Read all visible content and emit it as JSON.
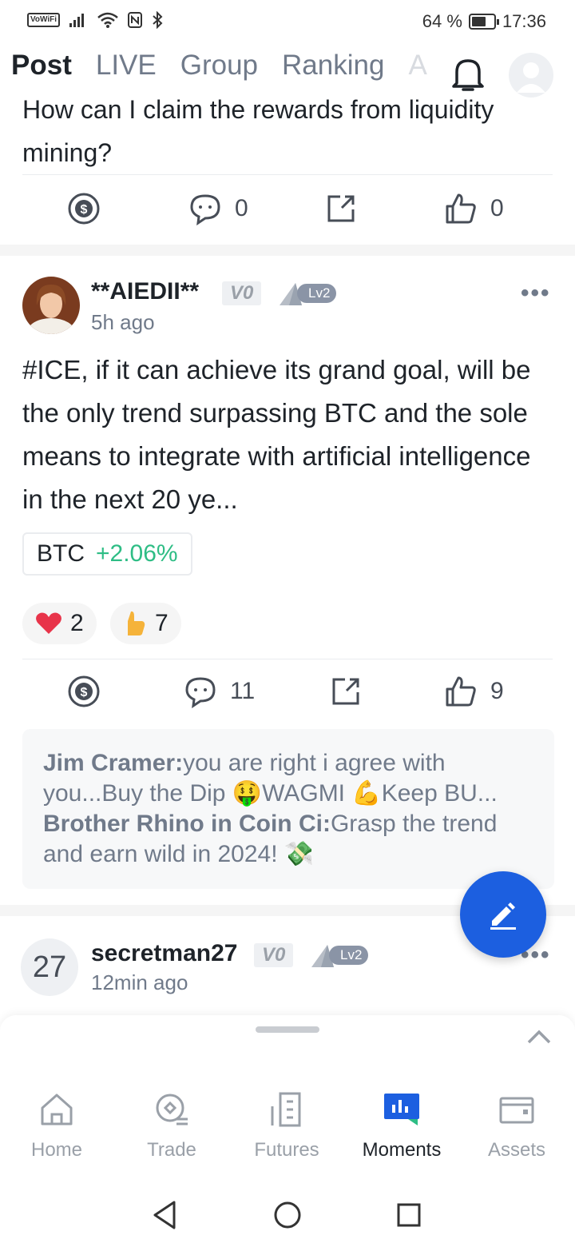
{
  "status_bar": {
    "vowifi": "VoWiFi",
    "battery": "64 %",
    "battery_level": 0.64,
    "time": "17:36"
  },
  "top_nav": {
    "tabs": [
      {
        "label": "Post"
      },
      {
        "label": "LIVE"
      },
      {
        "label": "Group"
      },
      {
        "label": "Ranking"
      },
      {
        "label": "A"
      }
    ]
  },
  "feed": {
    "prev_post": {
      "title_partial": "How can I claim the rewards from liquidity mining?",
      "comments": "0",
      "likes": "0"
    },
    "post1": {
      "username": "**AIEDII**",
      "v_badge": "V0",
      "level_badge": "Lv2",
      "time": "5h ago",
      "body": "#ICE, if it can achieve its grand goal, will be the only trend surpassing BTC and the sole means to integrate with artificial intelligence in the next 20 ye...",
      "ticker": "BTC",
      "ticker_change": "+2.06%",
      "reactions": [
        {
          "emoji": "heart",
          "count": "2"
        },
        {
          "emoji": "thumbs-up",
          "count": "7"
        }
      ],
      "comments": "11",
      "likes": "9",
      "top_comments": [
        {
          "name": "Jim Cramer:",
          "text": "you are right i agree with you...Buy the Dip 🤑WAGMI 💪Keep BU..."
        },
        {
          "name": "Brother Rhino in Coin Ci:",
          "text": "Grasp the trend and earn wild in 2024! 💸"
        }
      ]
    },
    "post2": {
      "avatar_text": "27",
      "username": "secretman27",
      "v_badge": "V0",
      "level_badge": "Lv2",
      "time": "12min ago"
    }
  },
  "bottom_nav": {
    "items": [
      {
        "label": "Home"
      },
      {
        "label": "Trade"
      },
      {
        "label": "Futures"
      },
      {
        "label": "Moments"
      },
      {
        "label": "Assets"
      }
    ],
    "active": "Moments"
  },
  "colors": {
    "accent": "#1c5fe0",
    "positive": "#2ebd85",
    "text": "#1e2329",
    "muted": "#707a8a"
  }
}
